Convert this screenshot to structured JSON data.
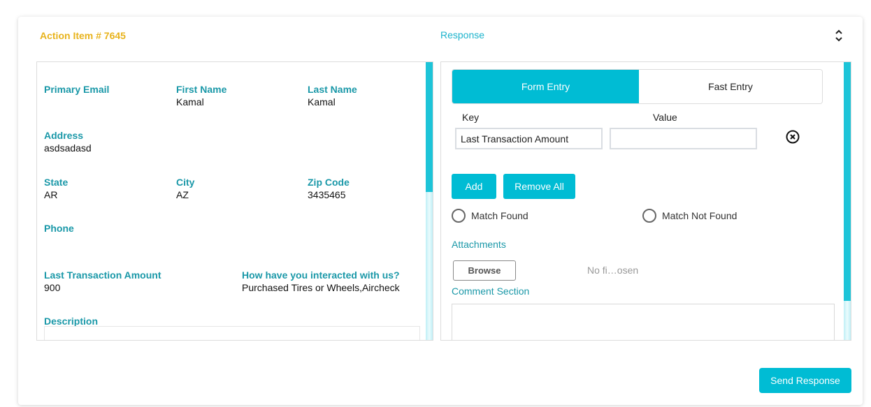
{
  "header": {
    "action_item_title": "Action Item # 7645",
    "response_title": "Response",
    "collapse_icon": "chevron-up-down-icon"
  },
  "customer": {
    "primary_email": {
      "label": "Primary Email",
      "value": ""
    },
    "first_name": {
      "label": "First Name",
      "value": "Kamal"
    },
    "last_name": {
      "label": "Last Name",
      "value": "Kamal"
    },
    "address": {
      "label": "Address",
      "value": "asdsadasd"
    },
    "state": {
      "label": "State",
      "value": "AR"
    },
    "city": {
      "label": "City",
      "value": "AZ"
    },
    "zip_code": {
      "label": "Zip Code",
      "value": "3435465"
    },
    "phone": {
      "label": "Phone",
      "value": ""
    },
    "last_transaction_amount": {
      "label": "Last Transaction Amount",
      "value": "900"
    },
    "interaction": {
      "label": "How have you interacted with us?",
      "value": "Purchased Tires or Wheels,Aircheck"
    },
    "description": {
      "label": "Description",
      "value": ""
    }
  },
  "response": {
    "tabs": [
      {
        "label": "Form Entry",
        "active": true
      },
      {
        "label": "Fast Entry",
        "active": false
      }
    ],
    "key_label": "Key",
    "value_label": "Value",
    "rows": [
      {
        "key": "Last Transaction Amount",
        "value": "",
        "remove_icon": "circle-x-icon"
      }
    ],
    "add_label": "Add",
    "remove_all_label": "Remove All",
    "radio_options": [
      {
        "label": "Match Found",
        "selected": false
      },
      {
        "label": "Match Not Found",
        "selected": false
      }
    ],
    "attachments_label": "Attachments",
    "browse_label": "Browse",
    "file_status": "No fi…osen",
    "comment_label": "Comment Section",
    "comment_value": "",
    "send_label": "Send Response"
  },
  "colors": {
    "accent": "#00bcd4",
    "label_teal": "#1a98a8",
    "title_gold": "#e8b31c"
  }
}
